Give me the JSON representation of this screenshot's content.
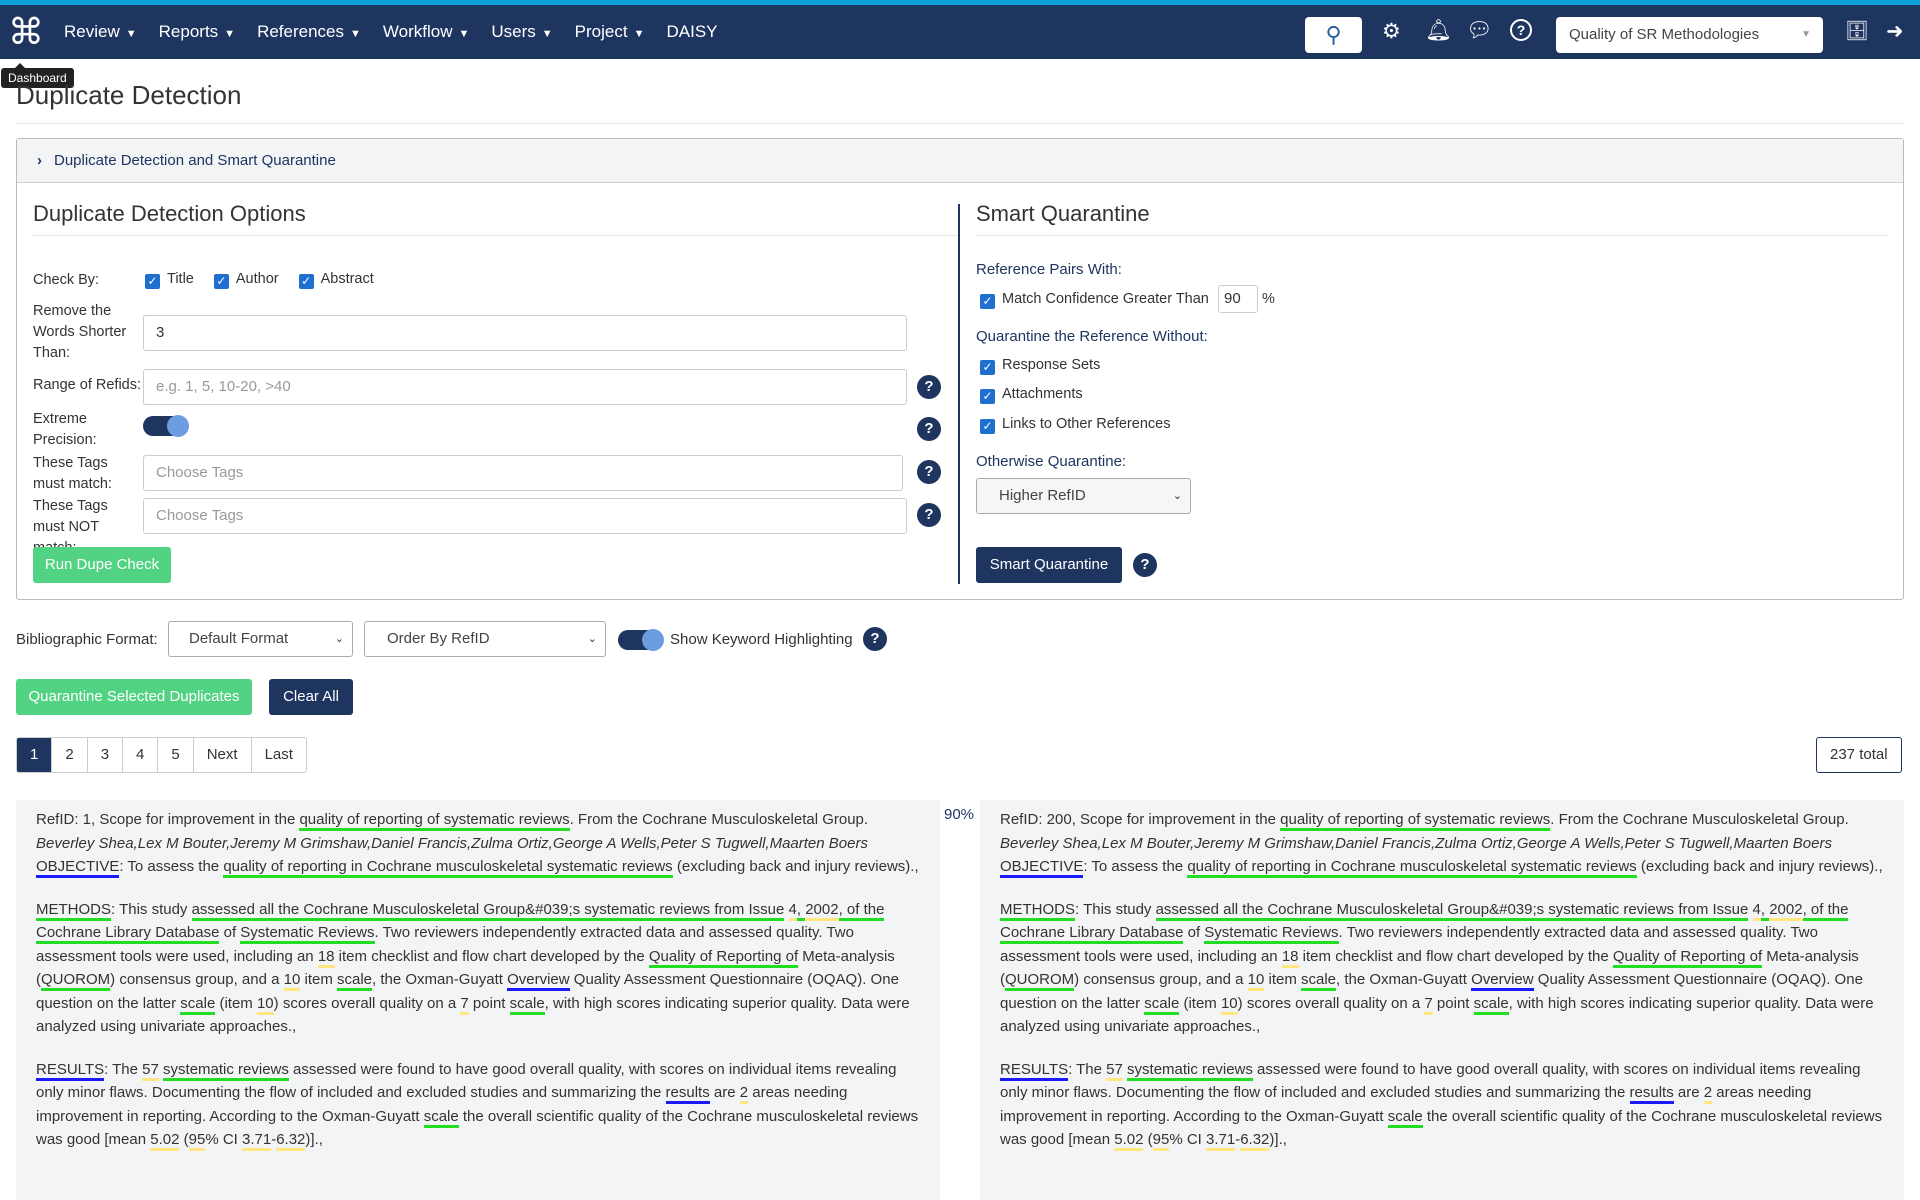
{
  "nav": {
    "logo_icon": "command-icon",
    "menu": [
      "Review",
      "Reports",
      "References",
      "Workflow",
      "Users",
      "Project"
    ],
    "daisy": "DAISY",
    "tooltip": "Dashboard",
    "project": "Quality of SR Methodologies"
  },
  "page": {
    "title": "Duplicate Detection",
    "panel_title": "Duplicate Detection and Smart Quarantine"
  },
  "options": {
    "heading": "Duplicate Detection Options",
    "check_by_label": "Check By:",
    "check_by": [
      "Title",
      "Author",
      "Abstract"
    ],
    "min_word_label": "Remove the Words Shorter Than:",
    "min_word_value": "3",
    "range_label": "Range of Refids:",
    "range_placeholder": "e.g. 1, 5, 10-20, >40",
    "precision_label": "Extreme Precision:",
    "precision_on": true,
    "tags_match_label": "These Tags must match:",
    "tags_not_label": "These Tags must NOT match:",
    "tags_placeholder": "Choose Tags",
    "run_button": "Run Dupe Check"
  },
  "quarantine": {
    "heading": "Smart Quarantine",
    "pairs_label": "Reference Pairs With:",
    "match_label": "Match Confidence Greater Than",
    "match_value": "90",
    "pct": "%",
    "without_label": "Quarantine the Reference Without:",
    "without": [
      "Response Sets",
      "Attachments",
      "Links to Other References"
    ],
    "otherwise_label": "Otherwise Quarantine:",
    "otherwise_value": "Higher RefID",
    "button": "Smart Quarantine"
  },
  "toolbar": {
    "format_label": "Bibliographic Format:",
    "format_value": "Default Format",
    "order_value": "Order By RefID",
    "highlight_label": "Show Keyword Highlighting",
    "highlight_on": true,
    "quarantine_button": "Quarantine Selected Duplicates",
    "clear_button": "Clear All"
  },
  "pagination": {
    "pages": [
      "1",
      "2",
      "3",
      "4",
      "5",
      "Next",
      "Last"
    ],
    "active": "1",
    "total": "237 total"
  },
  "colors": {
    "navy": "#1e3560",
    "green": "#52d384",
    "hl_green": "#22dd22",
    "hl_blue": "#1a1aff",
    "hl_yellow": "#ffe680"
  },
  "pair": {
    "score": "90%",
    "left_prefix": "RefID: 1, ",
    "right_prefix": "RefID: 200, ",
    "title": [
      [
        "Scope for improvement in the ",
        ""
      ],
      [
        "quality of reporting of systematic reviews",
        "g"
      ],
      [
        ". From the Cochrane Musculoskeletal Group.",
        ""
      ]
    ],
    "authors": "Beverley Shea,Lex M Bouter,Jeremy M Grimshaw,Daniel Francis,Zulma Ortiz,George A Wells,Peter S Tugwell,Maarten Boers",
    "objective": [
      [
        "OBJECTIVE",
        "b"
      ],
      [
        ": To assess the ",
        ""
      ],
      [
        "quality of reporting in Cochrane musculoskeletal systematic reviews",
        "g"
      ],
      [
        " (excluding back and injury reviews).,",
        ""
      ]
    ],
    "methods": [
      [
        "METHODS",
        "g"
      ],
      [
        ": This study ",
        ""
      ],
      [
        "assessed all the Cochrane Musculoskeletal Group&#039;s systematic reviews from Issue",
        "g"
      ],
      [
        " ",
        ""
      ],
      [
        "4",
        "y"
      ],
      [
        ", ",
        "g"
      ],
      [
        "2002",
        "y"
      ],
      [
        ", of the Cochrane Library Database",
        "g"
      ],
      [
        " of ",
        ""
      ],
      [
        "Systematic Reviews",
        "g"
      ],
      [
        ". Two reviewers independently extracted data and assessed quality. Two assessment tools were used, including an ",
        ""
      ],
      [
        "18",
        "y"
      ],
      [
        " item checklist and flow chart developed by the ",
        ""
      ],
      [
        "Quality of Reporting of",
        "g"
      ],
      [
        " Meta-analysis (",
        ""
      ],
      [
        "QUOROM",
        "g"
      ],
      [
        ") consensus group, and a ",
        ""
      ],
      [
        "10",
        "y"
      ],
      [
        " item ",
        ""
      ],
      [
        "scale",
        "g"
      ],
      [
        ", the Oxman-Guyatt ",
        ""
      ],
      [
        "Overview",
        "b"
      ],
      [
        " Quality Assessment Questionnaire (OQAQ). One question on the latter ",
        ""
      ],
      [
        "scale",
        "g"
      ],
      [
        " (item ",
        ""
      ],
      [
        "10",
        "y"
      ],
      [
        ") scores overall quality on a ",
        ""
      ],
      [
        "7",
        "y"
      ],
      [
        " point ",
        ""
      ],
      [
        "scale",
        "g"
      ],
      [
        ", with high scores indicating superior quality. Data were analyzed using univariate approaches.,",
        ""
      ]
    ],
    "results": [
      [
        "RESULTS",
        "b"
      ],
      [
        ": The ",
        ""
      ],
      [
        "57",
        "y"
      ],
      [
        " ",
        ""
      ],
      [
        "systematic reviews",
        "g"
      ],
      [
        " assessed were found to have good overall quality, with scores on individual items revealing only minor flaws. Documenting the flow of included and excluded studies and summarizing the ",
        ""
      ],
      [
        "results",
        "b"
      ],
      [
        " are ",
        ""
      ],
      [
        "2",
        "y"
      ],
      [
        " areas needing improvement in reporting. According to the Oxman-Guyatt ",
        ""
      ],
      [
        "scale",
        "g"
      ],
      [
        " the overall scientific quality of the Cochrane musculoskeletal reviews was good [mean ",
        ""
      ],
      [
        "5.02",
        "y"
      ],
      [
        " (",
        ""
      ],
      [
        "95",
        "y"
      ],
      [
        "% CI ",
        ""
      ],
      [
        "3.71",
        "y"
      ],
      [
        "-",
        ""
      ],
      [
        "6.32",
        "y"
      ],
      [
        ")].,",
        ""
      ]
    ]
  }
}
